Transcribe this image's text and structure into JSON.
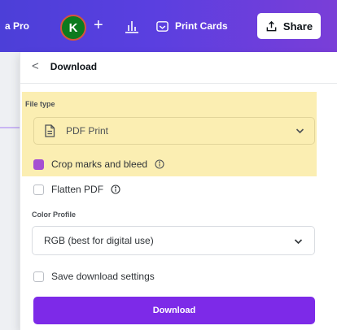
{
  "topbar": {
    "pro_label": "a Pro",
    "avatar_letter": "K",
    "add_symbol": "+",
    "print_cards_label": "Print Cards",
    "share_label": "Share"
  },
  "panel": {
    "back_symbol": "<",
    "title": "Download",
    "file_type_label": "File type",
    "file_type_value": "PDF Print",
    "crop_marks_label": "Crop marks and bleed",
    "crop_marks_checked": true,
    "flatten_label": "Flatten PDF",
    "flatten_checked": false,
    "color_profile_label": "Color Profile",
    "color_profile_value": "RGB (best for digital use)",
    "save_settings_label": "Save download settings",
    "save_settings_checked": false,
    "download_button_label": "Download"
  },
  "colors": {
    "topbar_start": "#4c3fd8",
    "topbar_end": "#7a3ed8",
    "highlight": "#fbeeb2",
    "accent_purple": "#7d2ae8",
    "checkbox_on": "#a64fd2",
    "avatar_bg": "#0c7a1e"
  },
  "icons": {
    "insights": "bar-chart-icon",
    "print": "printer-icon",
    "share": "share-upload-icon",
    "file": "document-icon",
    "info": "info-circle-icon",
    "dropdown": "chevron-down-icon"
  }
}
